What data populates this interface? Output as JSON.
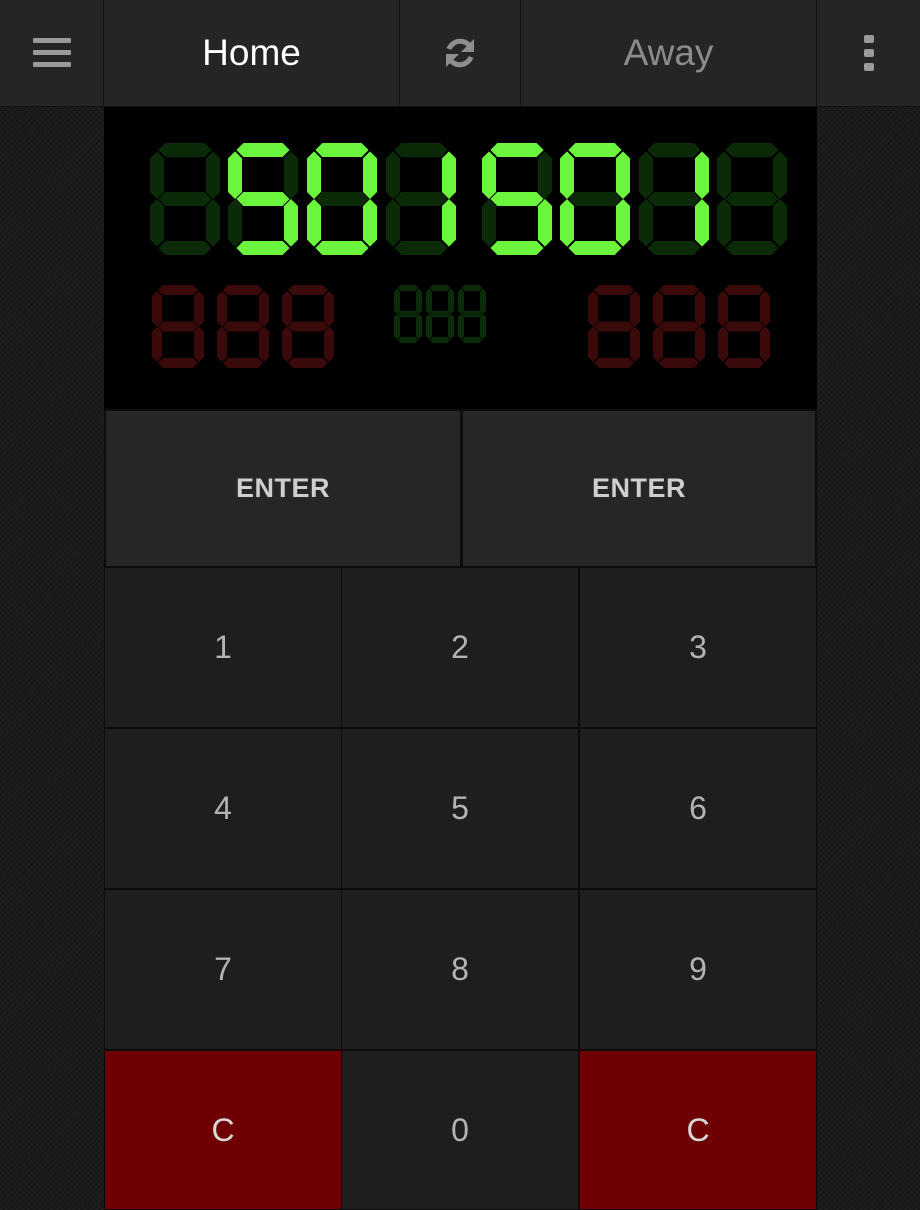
{
  "topbar": {
    "menu_icon": "hamburger-menu-icon",
    "home_label": "Home",
    "sync_icon": "refresh-icon",
    "away_label": "Away",
    "more_icon": "vertical-dots-icon"
  },
  "scoreboard": {
    "home_score": "501",
    "away_score": "501",
    "lit_color": "#6cf53d",
    "dim_green": "#0b2a07",
    "dim_red": "#3a0a0a"
  },
  "buttons": {
    "enter_home": "ENTER",
    "enter_away": "ENTER"
  },
  "keypad": {
    "keys": [
      "1",
      "2",
      "3",
      "4",
      "5",
      "6",
      "7",
      "8",
      "9",
      "C",
      "0",
      "C"
    ],
    "clear_color": "#6e0003"
  }
}
